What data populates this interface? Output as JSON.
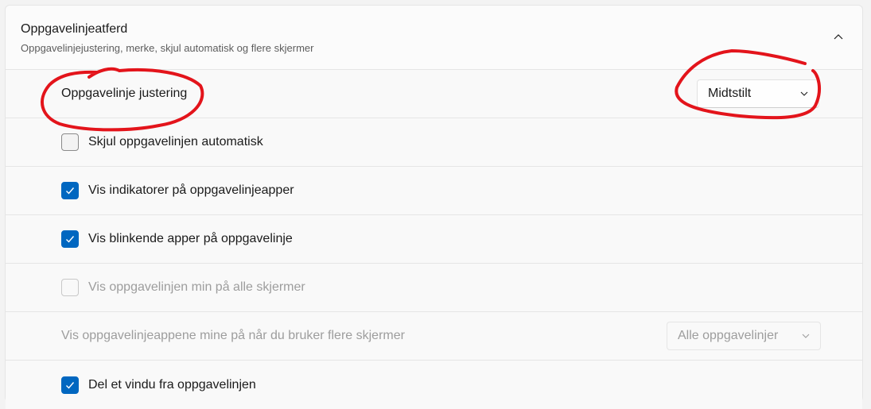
{
  "section": {
    "title": "Oppgavelinjeatferd",
    "subtitle": "Oppgavelinjejustering, merke, skjul automatisk og flere skjermer"
  },
  "alignment": {
    "label": "Oppgavelinje justering",
    "value": "Midtstilt"
  },
  "options": [
    {
      "label": "Skjul oppgavelinjen automatisk",
      "checked": false,
      "disabled": false
    },
    {
      "label": "Vis indikatorer på oppgavelinjeapper",
      "checked": true,
      "disabled": false
    },
    {
      "label": "Vis blinkende apper på oppgavelinje",
      "checked": true,
      "disabled": false
    },
    {
      "label": "Vis oppgavelinjen min på alle skjermer",
      "checked": false,
      "disabled": true
    }
  ],
  "multi_display": {
    "label": "Vis oppgavelinjeappene mine på når du bruker flere skjermer",
    "value": "Alle oppgavelinjer"
  },
  "share_window": {
    "label": "Del et vindu fra oppgavelinjen",
    "checked": true
  },
  "colors": {
    "accent": "#0067c0",
    "annotation": "#e3141b"
  },
  "icons": {
    "collapse": "chevron-up-icon",
    "dropdown": "chevron-down-icon",
    "check": "checkmark-icon"
  }
}
